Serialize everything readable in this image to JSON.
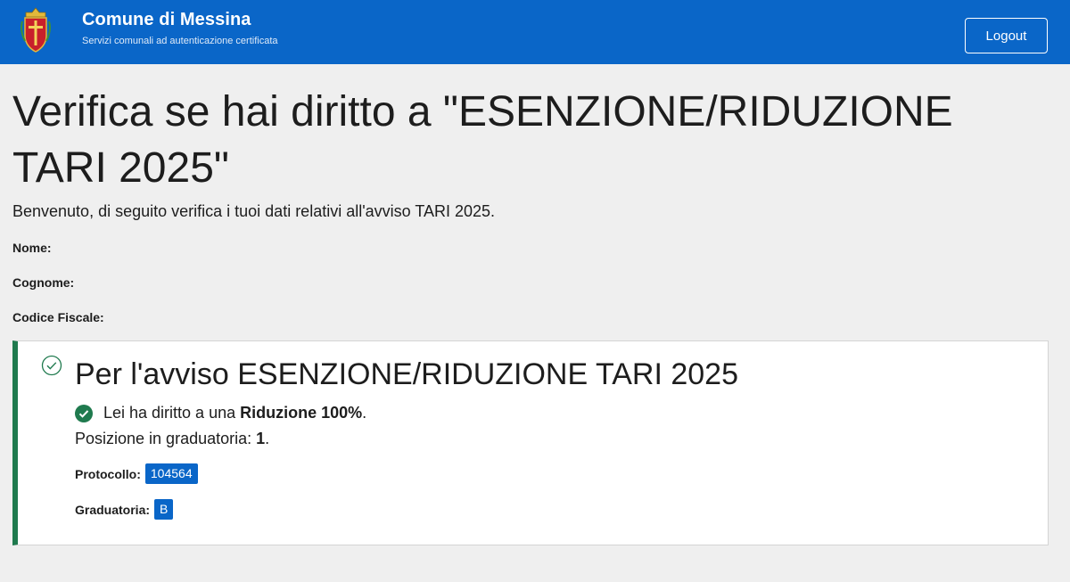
{
  "header": {
    "title": "Comune di Messina",
    "subtitle": "Servizi comunali ad autenticazione certificata",
    "logout_label": "Logout",
    "logo_icon": "crest-icon",
    "bg_color": "#0a66c8"
  },
  "page": {
    "title": "Verifica se hai diritto a \"ESENZIONE/RIDUZIONE TARI 2025\"",
    "intro": "Benvenuto, di seguito verifica i tuoi dati relativi all'avviso TARI 2025."
  },
  "user": {
    "nome_label": "Nome:",
    "nome_value": "",
    "cognome_label": "Cognome:",
    "cognome_value": "",
    "cf_label": "Codice Fiscale:",
    "cf_value": ""
  },
  "result": {
    "title": "Per l'avviso ESENZIONE/RIDUZIONE TARI 2025",
    "status_icon": "check-circle-outline-icon",
    "eligibility_prefix": "Lei ha diritto a una ",
    "eligibility_value": "Riduzione 100%",
    "eligibility_suffix": ".",
    "rank_prefix": "Posizione in graduatoria: ",
    "rank_value": "1",
    "rank_suffix": ".",
    "protocol_label": "Protocollo:",
    "protocol_value": "104564",
    "ranking_label": "Graduatoria:",
    "ranking_value": "B",
    "accent_color": "#1f7a4e"
  }
}
